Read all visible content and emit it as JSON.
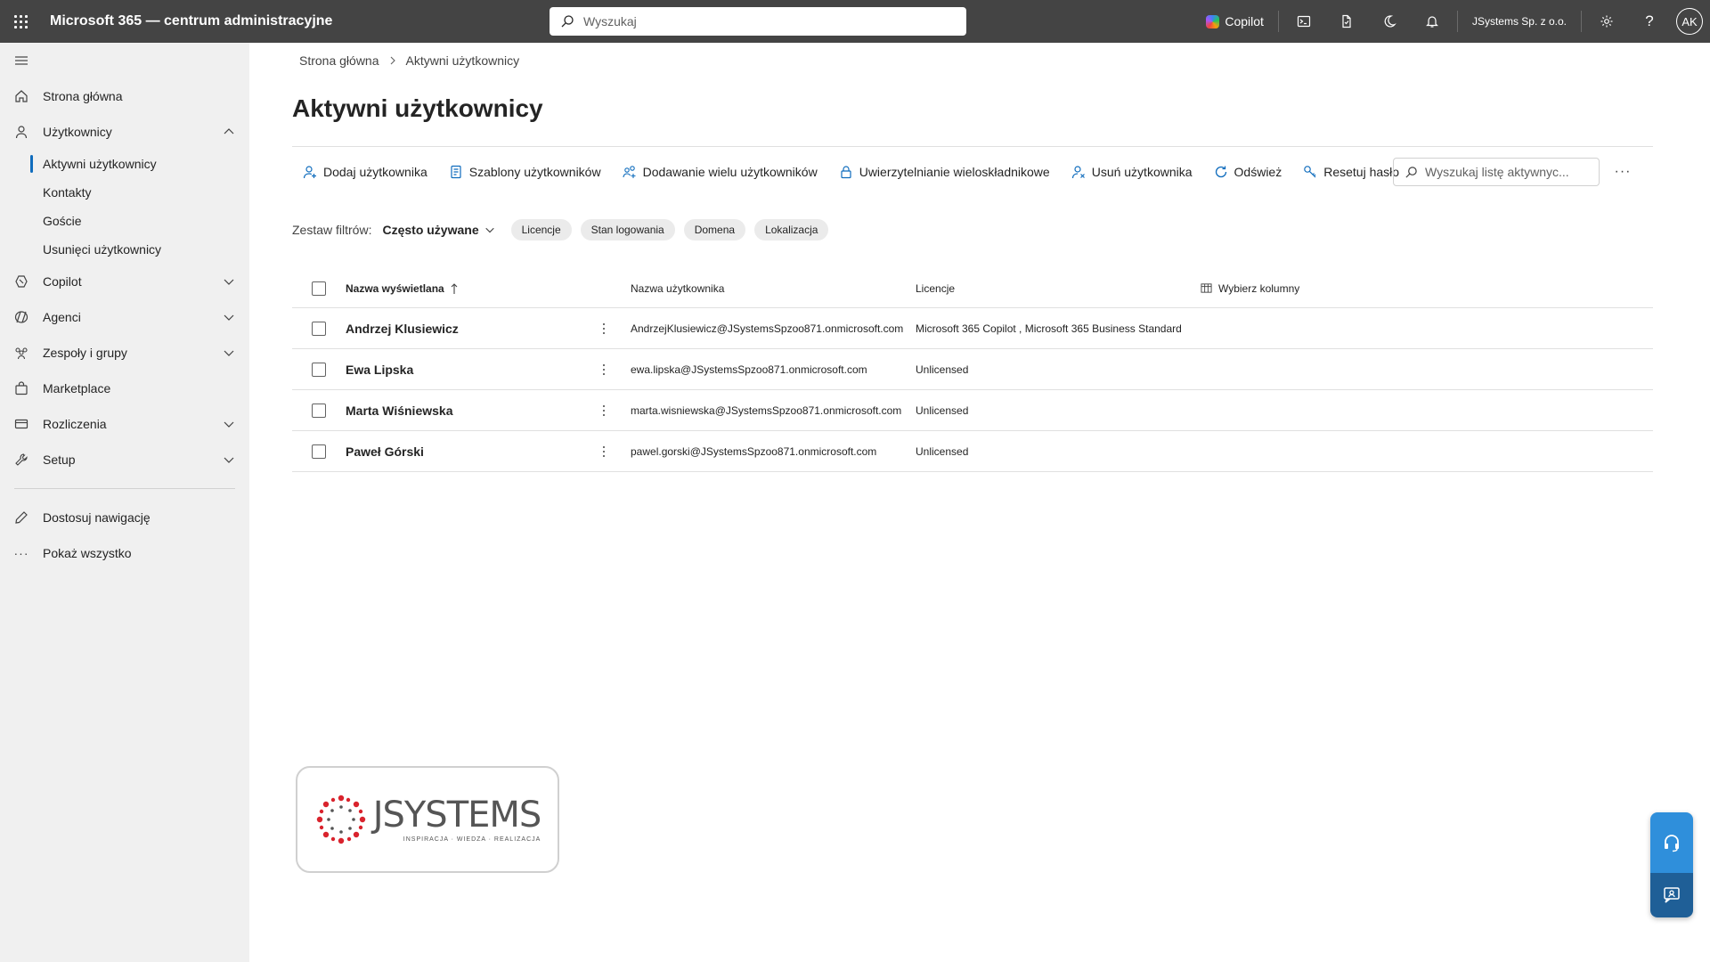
{
  "app": {
    "title": "Microsoft 365 — centrum administracyjne"
  },
  "topbar": {
    "search_placeholder": "Wyszukaj",
    "copilot_label": "Copilot",
    "tenant": "JSystems Sp. z o.o.",
    "avatar_initials": "AK"
  },
  "sidebar": {
    "items": [
      {
        "label": "Strona główna",
        "icon": "home-icon"
      },
      {
        "label": "Użytkownicy",
        "icon": "person-icon",
        "expanded": true
      },
      {
        "label": "Copilot",
        "icon": "copilot-icon"
      },
      {
        "label": "Agenci",
        "icon": "agents-icon"
      },
      {
        "label": "Zespoły i grupy",
        "icon": "people-team-icon"
      },
      {
        "label": "Marketplace",
        "icon": "shopping-bag-icon"
      },
      {
        "label": "Rozliczenia",
        "icon": "credit-card-icon"
      },
      {
        "label": "Setup",
        "icon": "wrench-icon"
      }
    ],
    "users_sub": [
      "Aktywni użytkownicy",
      "Kontakty",
      "Goście",
      "Usunięci użytkownicy"
    ],
    "customize": "Dostosuj nawigację",
    "show_all": "Pokaż wszystko"
  },
  "breadcrumb": {
    "home": "Strona główna",
    "current": "Aktywni użytkownicy"
  },
  "page": {
    "title": "Aktywni użytkownicy"
  },
  "toolbar": {
    "add_user": "Dodaj użytkownika",
    "templates": "Szablony użytkowników",
    "bulk_add": "Dodawanie wielu użytkowników",
    "mfa": "Uwierzytelnianie wieloskładnikowe",
    "delete_user": "Usuń użytkownika",
    "refresh": "Odśwież",
    "reset_password": "Resetuj hasło",
    "search_placeholder": "Wyszukaj listę aktywnyc..."
  },
  "filters": {
    "label": "Zestaw filtrów:",
    "selected": "Często używane",
    "pills": [
      "Licencje",
      "Stan logowania",
      "Domena",
      "Lokalizacja"
    ]
  },
  "table": {
    "columns": {
      "display_name": "Nazwa wyświetlana",
      "username": "Nazwa użytkownika",
      "licenses": "Licencje",
      "choose_columns": "Wybierz kolumny"
    },
    "rows": [
      {
        "name": "Andrzej Klusiewicz",
        "username": "AndrzejKlusiewicz@JSystemsSpzoo871.onmicrosoft.com",
        "licenses": "Microsoft 365 Copilot , Microsoft 365 Business Standard"
      },
      {
        "name": "Ewa Lipska",
        "username": "ewa.lipska@JSystemsSpzoo871.onmicrosoft.com",
        "licenses": "Unlicensed"
      },
      {
        "name": "Marta Wiśniewska",
        "username": "marta.wisniewska@JSystemsSpzoo871.onmicrosoft.com",
        "licenses": "Unlicensed"
      },
      {
        "name": "Paweł Górski",
        "username": "pawel.gorski@JSystemsSpzoo871.onmicrosoft.com",
        "licenses": "Unlicensed"
      }
    ]
  },
  "logo": {
    "word": "JSYSTEMS",
    "tagline": "INSPIRACJA · WIEDZA · REALIZACJA"
  },
  "colors": {
    "topbar": "#444444",
    "sidebar": "#f0f0f0",
    "accent": "#0f6cbd",
    "logo_red": "#d9232d"
  }
}
